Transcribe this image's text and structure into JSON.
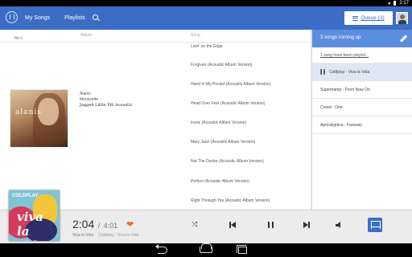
{
  "statusbar": {
    "time": "2:17"
  },
  "appbar": {
    "nav": [
      "My Songs",
      "Playlists"
    ],
    "queue_label": "Queue (3)"
  },
  "library": {
    "columns": {
      "artist": "Artist",
      "album": "Album",
      "song": "Song"
    },
    "album": {
      "cover_text": "alanis",
      "artist": "Alanis",
      "artist_alt": "Morissette",
      "name": "Jagged Little Pill Acoustic"
    },
    "songs": [
      "Livin' on the Edge",
      "Forgiven (Acoustic Album Version)",
      "Hand In My Pocket (Acoustic Album Version)",
      "Head Over Feet (Acoustic Album Version)",
      "Ironic (Acoustic Album Version)",
      "Mary Jane (Acoustic Album Version)",
      "Not The Doctor (Acoustic Album Version)",
      "Perfect (Acoustic Album Version)",
      "Right Through You (Acoustic Album Version)"
    ]
  },
  "queue": {
    "header": "3 songs coming up",
    "note": "1 song have been played...",
    "items": [
      "Coldplay - Viva la Vida",
      "Supertramp - From Now On",
      "Creed - One",
      "Apocalyptica - Faraway"
    ]
  },
  "player": {
    "current_time": "2:04",
    "separator": "/",
    "duration": "4:01",
    "track": "Viva la Vida",
    "artist_album": "Coldplay - Viva la Vida",
    "art_band": "COLDPLAY",
    "art_title": "viva la vida"
  },
  "colors": {
    "accent": "#3b6dc4",
    "queue_header": "#5c8ee0",
    "heart": "#f06b22"
  }
}
